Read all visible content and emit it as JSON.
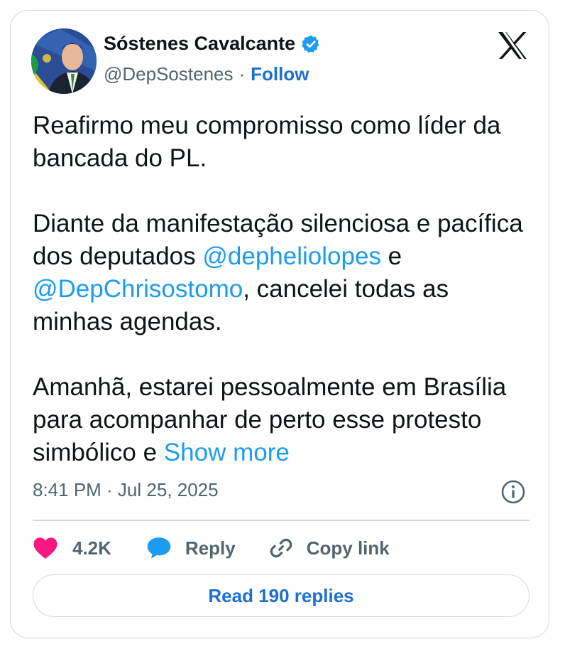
{
  "author": {
    "name": "Sóstenes Cavalcante",
    "handle": "@DepSostenes",
    "separator": "·",
    "follow_label": "Follow"
  },
  "tweet": {
    "paragraph1": "Reafirmo meu compromisso como líder da bancada do PL.",
    "paragraph2": {
      "part1": "Diante da manifestação silenciosa e pacífica dos deputados ",
      "mention1": "@depheliolopes",
      "part2": " e ",
      "mention2": "@DepChrisostomo",
      "part3": ", cancelei todas as minhas agendas."
    },
    "paragraph3": {
      "text": "Amanhã, estarei pessoalmente em Brasília para acompanhar de perto esse protesto simbólico e ",
      "show_more": "Show more"
    },
    "timestamp": "8:41 PM · Jul 25, 2025"
  },
  "actions": {
    "like_count": "4.2K",
    "reply_label": "Reply",
    "copy_link_label": "Copy link"
  },
  "read_replies_label": "Read 190 replies",
  "icons": {
    "verified": "verified-badge-icon",
    "x_logo": "x-logo-icon",
    "info": "info-icon",
    "like": "heart-icon",
    "reply": "speech-bubble-icon",
    "copy": "link-icon"
  },
  "colors": {
    "like": "#f91880",
    "reply": "#1d9bf0",
    "link": "#1d9bf0",
    "follow": "#1d6fd0",
    "verified": "#1d9bf0"
  }
}
